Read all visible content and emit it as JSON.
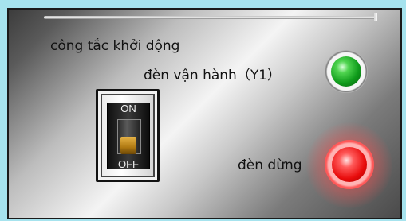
{
  "labels": {
    "start_switch": "công tắc khởi động",
    "run_lamp": "đèn vận hành（Y1）",
    "stop_lamp": "đèn dừng"
  },
  "switch": {
    "on_text": "ON",
    "off_text": "OFF",
    "state": "OFF"
  },
  "lamps": {
    "run": {
      "color": "#11a11f",
      "state": "on"
    },
    "stop": {
      "color": "#e80c0c",
      "state": "on"
    }
  },
  "colors": {
    "background": "#a6e3ee",
    "panel_border": "#1a1a1a"
  }
}
